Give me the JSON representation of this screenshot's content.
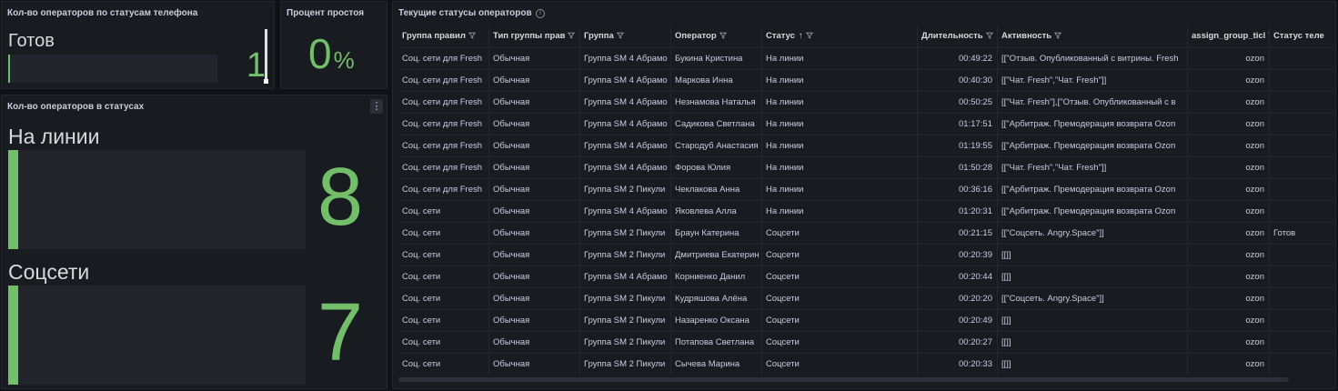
{
  "panel_phone": {
    "title": "Кол-во операторов по статусам телефона",
    "status_label": "Готов",
    "value": "1"
  },
  "panel_idle": {
    "title": "Процент простоя",
    "value": "0",
    "unit": "%"
  },
  "panel_statuses": {
    "title": "Кол-во операторов в статусах",
    "menu_icon": "kebab-menu-icon",
    "items": [
      {
        "label": "На линии",
        "value": "8"
      },
      {
        "label": "Соцсети",
        "value": "7"
      }
    ]
  },
  "table": {
    "title": "Текущие статусы операторов",
    "columns": [
      {
        "label": "Группа правил",
        "filter": true
      },
      {
        "label": "Тип группы прав",
        "filter": true
      },
      {
        "label": "Группа",
        "filter": true
      },
      {
        "label": "Оператор",
        "filter": true
      },
      {
        "label": "Статус",
        "sort": "↑",
        "filter": true
      },
      {
        "label": "Длительность",
        "filter": true
      },
      {
        "label": "Активность",
        "filter": true
      },
      {
        "label": "assign_group_ticl",
        "filter": true
      },
      {
        "label": "Статус теле",
        "filter": false
      }
    ],
    "rows": [
      [
        "Соц. сети для Fresh",
        "Обычная",
        "Группа SM 4 Абрамо",
        "Букина Кристина",
        "На линии",
        "00:49:22",
        "[[\"Отзыв. Опубликованный с витрины. Fresh",
        "ozon",
        ""
      ],
      [
        "Соц. сети для Fresh",
        "Обычная",
        "Группа SM 4 Абрамо",
        "Маркова Инна",
        "На линии",
        "00:40:30",
        "[[\"Чат. Fresh\",\"Чат. Fresh\"]]",
        "ozon",
        ""
      ],
      [
        "Соц. сети для Fresh",
        "Обычная",
        "Группа SM 4 Абрамо",
        "Незнамова Наталья",
        "На линии",
        "00:50:25",
        "[[\"Чат. Fresh\"],[\"Отзыв. Опубликованный с в",
        "ozon",
        ""
      ],
      [
        "Соц. сети для Fresh",
        "Обычная",
        "Группа SM 4 Абрамо",
        "Садикова Светлана",
        "На линии",
        "01:17:51",
        "[[\"Арбитраж. Премодерация возврата Ozon",
        "ozon",
        ""
      ],
      [
        "Соц. сети для Fresh",
        "Обычная",
        "Группа SM 4 Абрамо",
        "Стародуб Анастасия",
        "На линии",
        "01:19:55",
        "[[\"Арбитраж. Премодерация возврата Ozon",
        "ozon",
        ""
      ],
      [
        "Соц. сети для Fresh",
        "Обычная",
        "Группа SM 4 Абрамо",
        "Форова Юлия",
        "На линии",
        "01:50:28",
        "[[\"Чат. Fresh\",\"Чат. Fresh\"]]",
        "ozon",
        ""
      ],
      [
        "Соц. сети для Fresh",
        "Обычная",
        "Группа SM 2 Пикули",
        "Чеклакова Анна",
        "На линии",
        "00:36:16",
        "[[\"Арбитраж. Премодерация возврата Ozon",
        "ozon",
        ""
      ],
      [
        "Соц. сети",
        "Обычная",
        "Группа SM 4 Абрамо",
        "Яковлева Алла",
        "На линии",
        "01:20:31",
        "[[\"Арбитраж. Премодерация возврата Ozon",
        "ozon",
        ""
      ],
      [
        "Соц. сети",
        "Обычная",
        "Группа SM 2 Пикули",
        "Браун Катерина",
        "Соцсети",
        "00:21:15",
        "[[\"Соцсеть. Angry.Space\"]]",
        "ozon",
        "Готов"
      ],
      [
        "Соц. сети",
        "Обычная",
        "Группа SM 2 Пикули",
        "Дмитриева Екатерин",
        "Соцсети",
        "00:20:39",
        "[[]]",
        "ozon",
        ""
      ],
      [
        "Соц. сети",
        "Обычная",
        "Группа SM 4 Абрамо",
        "Корниенко Данил",
        "Соцсети",
        "00:20:44",
        "[[]]",
        "ozon",
        ""
      ],
      [
        "Соц. сети",
        "Обычная",
        "Группа SM 2 Пикули",
        "Кудряшова Алёна",
        "Соцсети",
        "00:20:20",
        "[[\"Соцсеть. Angry.Space\"]]",
        "ozon",
        ""
      ],
      [
        "Соц. сети",
        "Обычная",
        "Группа SM 2 Пикули",
        "Назаренко Оксана",
        "Соцсети",
        "00:20:49",
        "[[]]",
        "ozon",
        ""
      ],
      [
        "Соц. сети",
        "Обычная",
        "Группа SM 2 Пикули",
        "Потапова Светлана",
        "Соцсети",
        "00:20:27",
        "[[]]",
        "ozon",
        ""
      ],
      [
        "Соц. сети",
        "Обычная",
        "Группа SM 2 Пикули",
        "Сычева Марина",
        "Соцсети",
        "00:20:33",
        "[[]]",
        "ozon",
        ""
      ]
    ]
  },
  "colors": {
    "accent_green": "#73bf69",
    "panel_bg": "#181b1f",
    "page_bg": "#111217"
  }
}
